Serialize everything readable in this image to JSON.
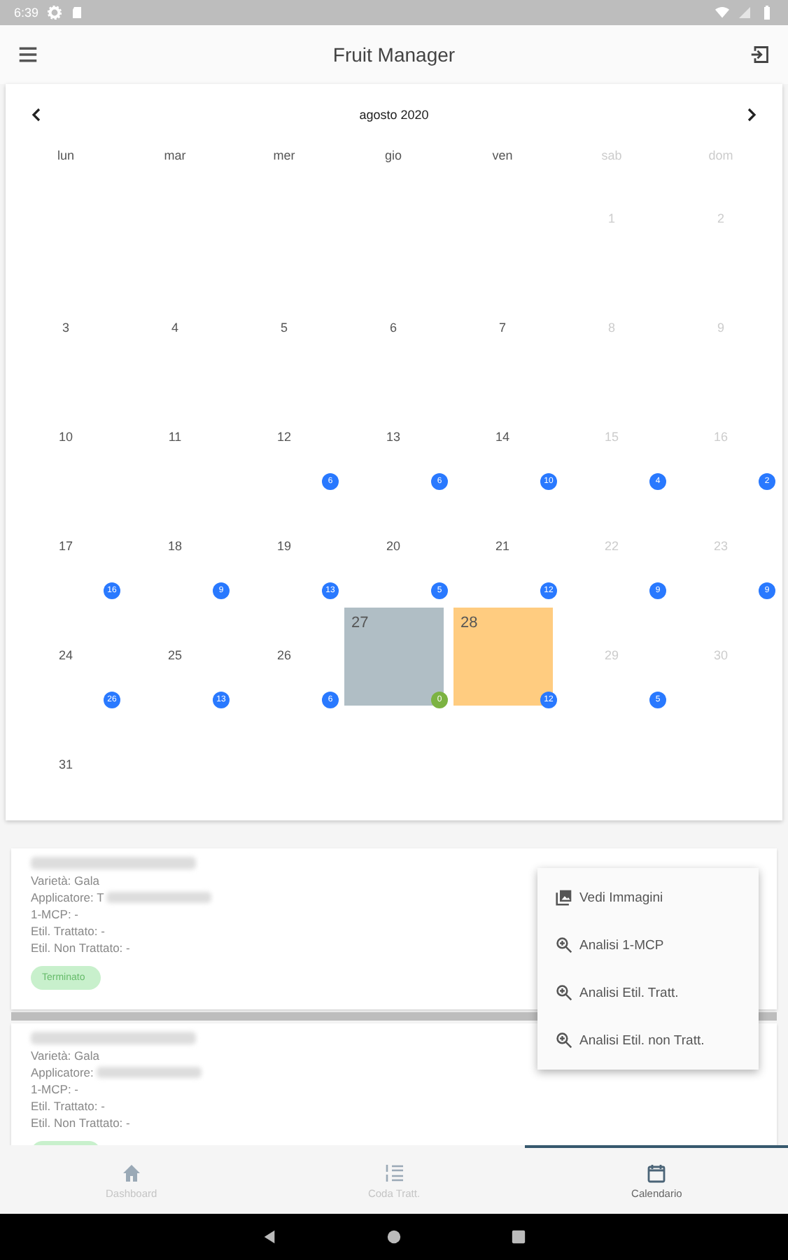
{
  "status_bar": {
    "time": "6:39"
  },
  "app_bar": {
    "title": "Fruit Manager"
  },
  "calendar": {
    "month": "agosto 2020",
    "weekdays": [
      {
        "label": "lun",
        "weekend": false
      },
      {
        "label": "mar",
        "weekend": false
      },
      {
        "label": "mer",
        "weekend": false
      },
      {
        "label": "gio",
        "weekend": false
      },
      {
        "label": "ven",
        "weekend": false
      },
      {
        "label": "sab",
        "weekend": true
      },
      {
        "label": "dom",
        "weekend": true
      }
    ],
    "weeks": [
      {
        "days": [
          {
            "label": "1",
            "weekend": true
          },
          {
            "label": "2",
            "weekend": true
          }
        ]
      },
      {
        "days": [
          {
            "label": "3",
            "weekend": false
          },
          {
            "label": "4",
            "weekend": false
          },
          {
            "label": "5",
            "weekend": false
          },
          {
            "label": "6",
            "weekend": false
          },
          {
            "label": "7",
            "weekend": false
          },
          {
            "label": "8",
            "weekend": true
          },
          {
            "label": "9",
            "weekend": true
          }
        ]
      },
      {
        "days": [
          {
            "label": "10",
            "weekend": false
          },
          {
            "label": "11",
            "weekend": false
          },
          {
            "label": "12",
            "weekend": false,
            "badge": {
              "text": "6",
              "color": "#2979ff"
            }
          },
          {
            "label": "13",
            "weekend": false,
            "badge": {
              "text": "6",
              "color": "#2979ff"
            }
          },
          {
            "label": "14",
            "weekend": false,
            "badge": {
              "text": "10",
              "color": "#2979ff"
            }
          },
          {
            "label": "15",
            "weekend": true,
            "badge": {
              "text": "4",
              "color": "#2979ff"
            }
          },
          {
            "label": "16",
            "weekend": true,
            "badge": {
              "text": "2",
              "color": "#2979ff"
            }
          }
        ]
      },
      {
        "days": [
          {
            "label": "17",
            "weekend": false,
            "badge": {
              "text": "16",
              "color": "#2979ff"
            }
          },
          {
            "label": "18",
            "weekend": false,
            "badge": {
              "text": "9",
              "color": "#2979ff"
            }
          },
          {
            "label": "19",
            "weekend": false,
            "badge": {
              "text": "13",
              "color": "#2979ff"
            }
          },
          {
            "label": "20",
            "weekend": false,
            "badge": {
              "text": "5",
              "color": "#2979ff"
            }
          },
          {
            "label": "21",
            "weekend": false,
            "badge": {
              "text": "12",
              "color": "#2979ff"
            }
          },
          {
            "label": "22",
            "weekend": true,
            "badge": {
              "text": "9",
              "color": "#2979ff"
            }
          },
          {
            "label": "23",
            "weekend": true,
            "badge": {
              "text": "9",
              "color": "#2979ff"
            }
          }
        ]
      },
      {
        "days": [
          {
            "label": "24",
            "weekend": false,
            "badge": {
              "text": "26",
              "color": "#2979ff"
            }
          },
          {
            "label": "25",
            "weekend": false,
            "badge": {
              "text": "13",
              "color": "#2979ff"
            }
          },
          {
            "label": "26",
            "weekend": false,
            "badge": {
              "text": "6",
              "color": "#2979ff"
            }
          },
          {
            "label": "27",
            "color": "#b0bec5",
            "badge": {
              "text": "0",
              "color": "#7cb342"
            }
          },
          {
            "label": "28",
            "color": "#ffcc80",
            "badge": {
              "text": "12",
              "color": "#2979ff"
            }
          },
          {
            "label": "29",
            "weekend": true,
            "badge": {
              "text": "5",
              "color": "#2979ff"
            }
          },
          {
            "label": "30",
            "weekend": true
          }
        ]
      },
      {
        "days": [
          {
            "label": "31",
            "weekend": false
          }
        ]
      }
    ]
  },
  "cards": [
    {
      "lines": [
        {
          "text": "Varietà: Gala"
        },
        {
          "text": "Applicatore: T",
          "redacted": true
        },
        {
          "text": "1-MCP: -"
        },
        {
          "text": "Etil. Trattato: -"
        },
        {
          "text": "Etil. Non Trattato: -"
        }
      ],
      "status": "Terminato"
    },
    {
      "lines": [
        {
          "text": "Varietà: Gala"
        },
        {
          "text": "Applicatore:",
          "redacted": true
        },
        {
          "text": "1-MCP: -"
        },
        {
          "text": "Etil. Trattato: -"
        },
        {
          "text": "Etil. Non Trattato: -"
        }
      ]
    }
  ],
  "menu": {
    "items": [
      {
        "kind": "images",
        "label": "Vedi Immagini"
      },
      {
        "kind": "zoom",
        "label": "Analisi 1-MCP"
      },
      {
        "kind": "zoom",
        "label": "Analisi Etil. Tratt."
      },
      {
        "kind": "zoom",
        "label": "Analisi Etil. non Tratt."
      }
    ]
  },
  "bottom_nav": {
    "tabs": [
      {
        "kind": "home",
        "label": "Dashboard",
        "selected": false
      },
      {
        "kind": "list",
        "label": "Coda Tratt.",
        "selected": false
      },
      {
        "kind": "calendar",
        "label": "Calendario",
        "selected": true
      }
    ]
  }
}
